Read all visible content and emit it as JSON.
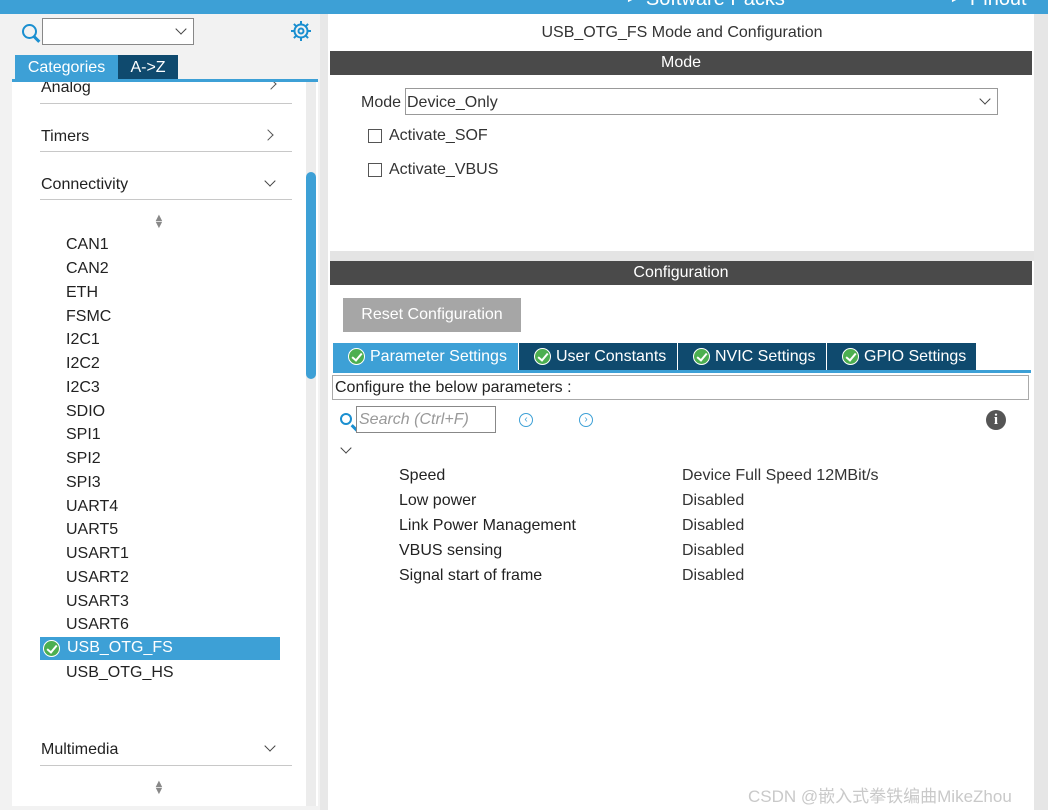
{
  "topbar": {
    "software_packs": "Software Packs",
    "pinout": "Pinout"
  },
  "left": {
    "tabs": {
      "categories": "Categories",
      "az": "A->Z"
    },
    "categories": {
      "analog": "Analog",
      "timers": "Timers",
      "connectivity": "Connectivity",
      "multimedia": "Multimedia"
    },
    "peripherals": [
      "CAN1",
      "CAN2",
      "ETH",
      "FSMC",
      "I2C1",
      "I2C2",
      "I2C3",
      "SDIO",
      "SPI1",
      "SPI2",
      "SPI3",
      "UART4",
      "UART5",
      "USART1",
      "USART2",
      "USART3",
      "USART6",
      "USB_OTG_FS",
      "USB_OTG_HS"
    ],
    "selected": "USB_OTG_FS"
  },
  "right": {
    "title": "USB_OTG_FS Mode and Configuration",
    "mode_header": "Mode",
    "mode_label": "Mode",
    "mode_value": "Device_Only",
    "checkboxes": [
      "Activate_SOF",
      "Activate_VBUS"
    ],
    "config_header": "Configuration",
    "reset_button": "Reset Configuration",
    "tabs": [
      "Parameter Settings",
      "User Constants",
      "NVIC Settings",
      "GPIO Settings"
    ],
    "configure_text": "Configure the below parameters :",
    "search_placeholder": "Search (Ctrl+F)",
    "parameters": [
      {
        "name": "Speed",
        "value": "Device Full Speed 12MBit/s"
      },
      {
        "name": "Low power",
        "value": "Disabled"
      },
      {
        "name": "Link Power Management",
        "value": "Disabled"
      },
      {
        "name": "VBUS sensing",
        "value": "Disabled"
      },
      {
        "name": "Signal start of frame",
        "value": "Disabled"
      }
    ]
  },
  "watermark": "CSDN @嵌入式拳铁编曲MikeZhou",
  "colors": {
    "accent": "#3da0d6",
    "dark_tab": "#0f4a6e",
    "header_bar": "#4a4a4a",
    "ok_green": "#4caf50"
  }
}
